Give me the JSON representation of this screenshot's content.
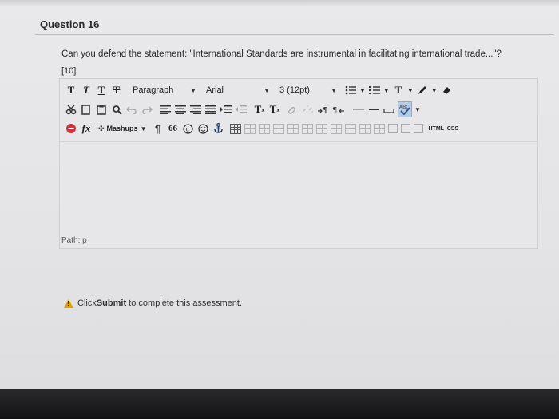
{
  "question": {
    "title": "Question 16",
    "text": "Can you defend the statement: \"International Standards are instrumental in facilitating international trade...\"?",
    "marks": "[10]"
  },
  "toolbar": {
    "row1": {
      "format_buttons": [
        "T",
        "T",
        "T",
        "T"
      ],
      "paragraph": "Paragraph",
      "font": "Arial",
      "size": "3 (12pt)",
      "text_color_label": "T"
    },
    "row2": {
      "superscript": "T",
      "superscript_mark": "x",
      "subscript": "T",
      "subscript_mark": "x"
    },
    "row3": {
      "fx": "fx",
      "mashups": "Mashups",
      "pilcrow": "¶",
      "quote": "66",
      "html": "HTML",
      "css": "CSS"
    }
  },
  "editor": {
    "path_label": "Path: p"
  },
  "footer": {
    "prefix": "Click ",
    "submit_word": "Submit",
    "suffix": " to complete this assessment."
  },
  "colors": {
    "warning": "#e0a400",
    "remove": "#d0333f",
    "spellcheck": "#3a6fb0"
  }
}
